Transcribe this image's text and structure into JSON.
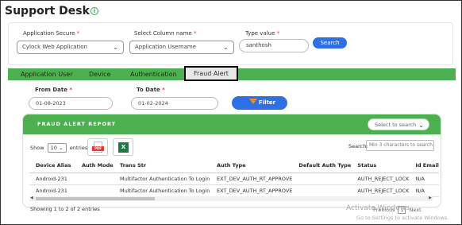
{
  "app": {
    "title": "Support Desk"
  },
  "filters": {
    "application_label": "Application Secure",
    "application_value": "Cylock Web Application",
    "column_label": "Select Column name",
    "column_value": "Application Username",
    "type_label": "Type value",
    "type_value": "santhosh",
    "search_button": "Search"
  },
  "tabs": [
    "Application User",
    "Device",
    "Authentication",
    "Fraud Alert"
  ],
  "active_tab": "Fraud Alert",
  "dates": {
    "from_label": "From Date",
    "from_value": "01-08-2023",
    "to_label": "To Date",
    "to_value": "01-02-2024",
    "filter_button": "Filter"
  },
  "report": {
    "title": "FRAUD ALERT REPORT",
    "select_placeholder": "Select to search",
    "show_label": "Show",
    "show_value": "10",
    "entries_label": "entries",
    "pdf_label": "PDF",
    "xls_label": "X",
    "search_label": "Search:",
    "search_placeholder": "Min 3 characters to search",
    "columns": [
      "Device Alias",
      "Auth Mode",
      "Trans Str",
      "Auth Type",
      "Default Auth Type",
      "Status",
      "Id Email"
    ],
    "rows": [
      [
        "Android-231",
        "",
        "Multifactor Authentication To Login",
        "EXT_DEV_AUTH_RT_APPROVE",
        "",
        "AUTH_REJECT_LOCK",
        "N/A"
      ],
      [
        "Android-231",
        "",
        "Multifactor Authentication To Login",
        "EXT_DEV_AUTH_RT_APPROVE",
        "",
        "AUTH_REJECT_LOCK",
        "N/A"
      ]
    ],
    "showing_text": "Showing 1 to 2 of 2 entries",
    "previous": "Previous",
    "page": "1",
    "next": "Next"
  },
  "watermark": {
    "line1": "Activate Windows",
    "line2": "Go to Settings to activate Windows."
  },
  "colors": {
    "green": "#4caf50",
    "blue": "#2f6fe4",
    "required": "#e53935"
  }
}
